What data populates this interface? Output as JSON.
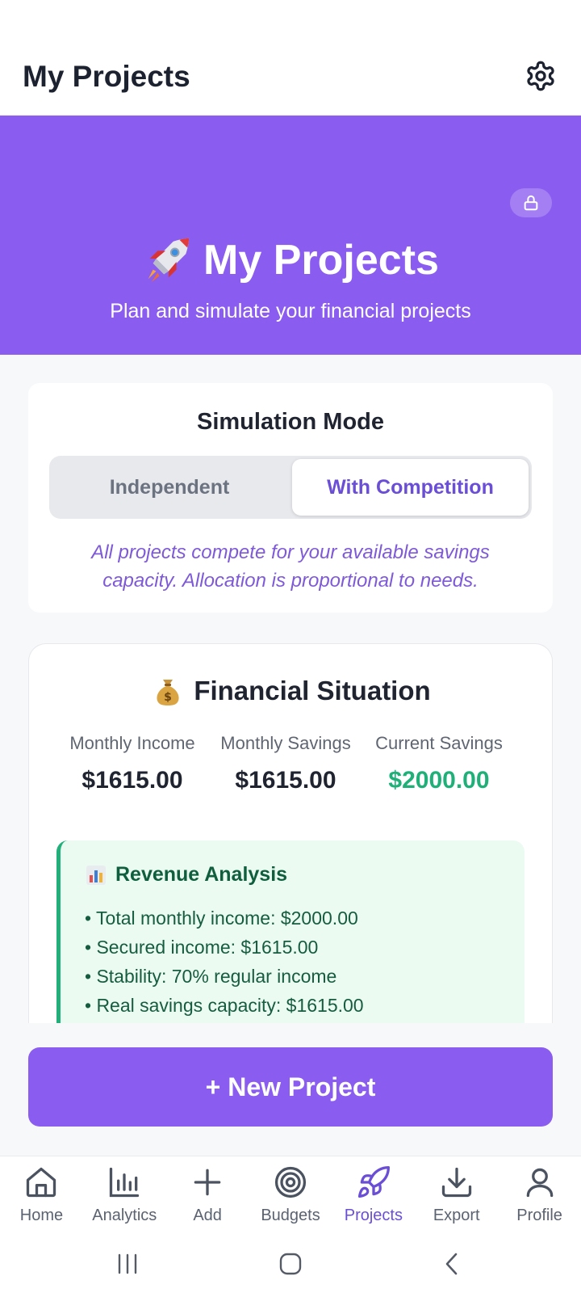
{
  "app_bar": {
    "title": "My Projects",
    "settings_icon": "gear-icon"
  },
  "hero": {
    "emoji": "rocket",
    "title": "My Projects",
    "subtitle": "Plan and simulate your financial projects",
    "lock_icon": "lock-icon",
    "background": "#8a5cf0"
  },
  "simulation": {
    "title": "Simulation Mode",
    "options": [
      "Independent",
      "With Competition"
    ],
    "selected": "With Competition",
    "description": "All projects compete for your available savings capacity. Allocation is proportional to needs."
  },
  "financial": {
    "emoji": "money-bag",
    "title": "Financial Situation",
    "stats": [
      {
        "label": "Monthly Income",
        "value": "$1615.00"
      },
      {
        "label": "Monthly Savings",
        "value": "$1615.00"
      },
      {
        "label": "Current Savings",
        "value": "$2000.00",
        "color": "#1fb07a"
      }
    ],
    "revenue_analysis": {
      "emoji": "bar-chart",
      "title": "Revenue Analysis",
      "items": [
        "• Total monthly income: $2000.00",
        "• Secured income: $1615.00",
        "• Stability: 70% regular income",
        "• Real savings capacity: $1615.00"
      ]
    }
  },
  "new_project_button": "+ New Project",
  "bottom_nav": [
    {
      "label": "Home",
      "icon": "home-icon"
    },
    {
      "label": "Analytics",
      "icon": "bar-chart-icon"
    },
    {
      "label": "Add",
      "icon": "plus-icon"
    },
    {
      "label": "Budgets",
      "icon": "target-icon"
    },
    {
      "label": "Projects",
      "icon": "rocket-icon",
      "active": true
    },
    {
      "label": "Export",
      "icon": "download-icon"
    },
    {
      "label": "Profile",
      "icon": "user-icon"
    }
  ],
  "accent_color": "#6a4fd6"
}
